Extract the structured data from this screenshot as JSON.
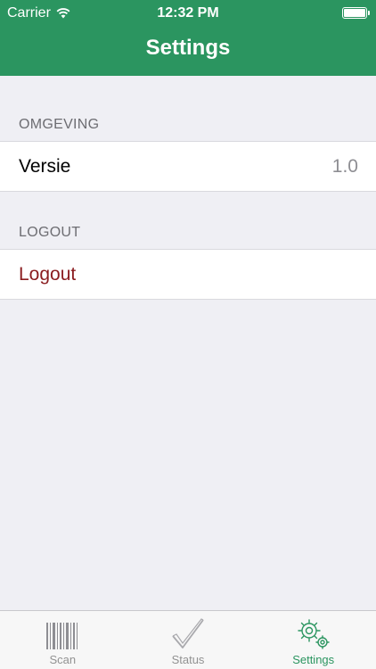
{
  "status_bar": {
    "carrier": "Carrier",
    "time": "12:32 PM",
    "wifi_icon": "wifi-icon",
    "battery_icon": "battery-icon"
  },
  "nav": {
    "title": "Settings"
  },
  "sections": [
    {
      "header": "OMGEVING",
      "rows": [
        {
          "label": "Versie",
          "detail": "1.0"
        }
      ]
    },
    {
      "header": "LOGOUT",
      "rows": [
        {
          "label": "Logout",
          "detail": ""
        }
      ]
    }
  ],
  "tabs": [
    {
      "label": "Scan",
      "icon": "barcode-icon",
      "active": false
    },
    {
      "label": "Status",
      "icon": "checkmark-icon",
      "active": false
    },
    {
      "label": "Settings",
      "icon": "gears-icon",
      "active": true
    }
  ],
  "colors": {
    "accent": "#2b9560",
    "logout_text": "#8a1c1f",
    "background": "#efeff4"
  }
}
